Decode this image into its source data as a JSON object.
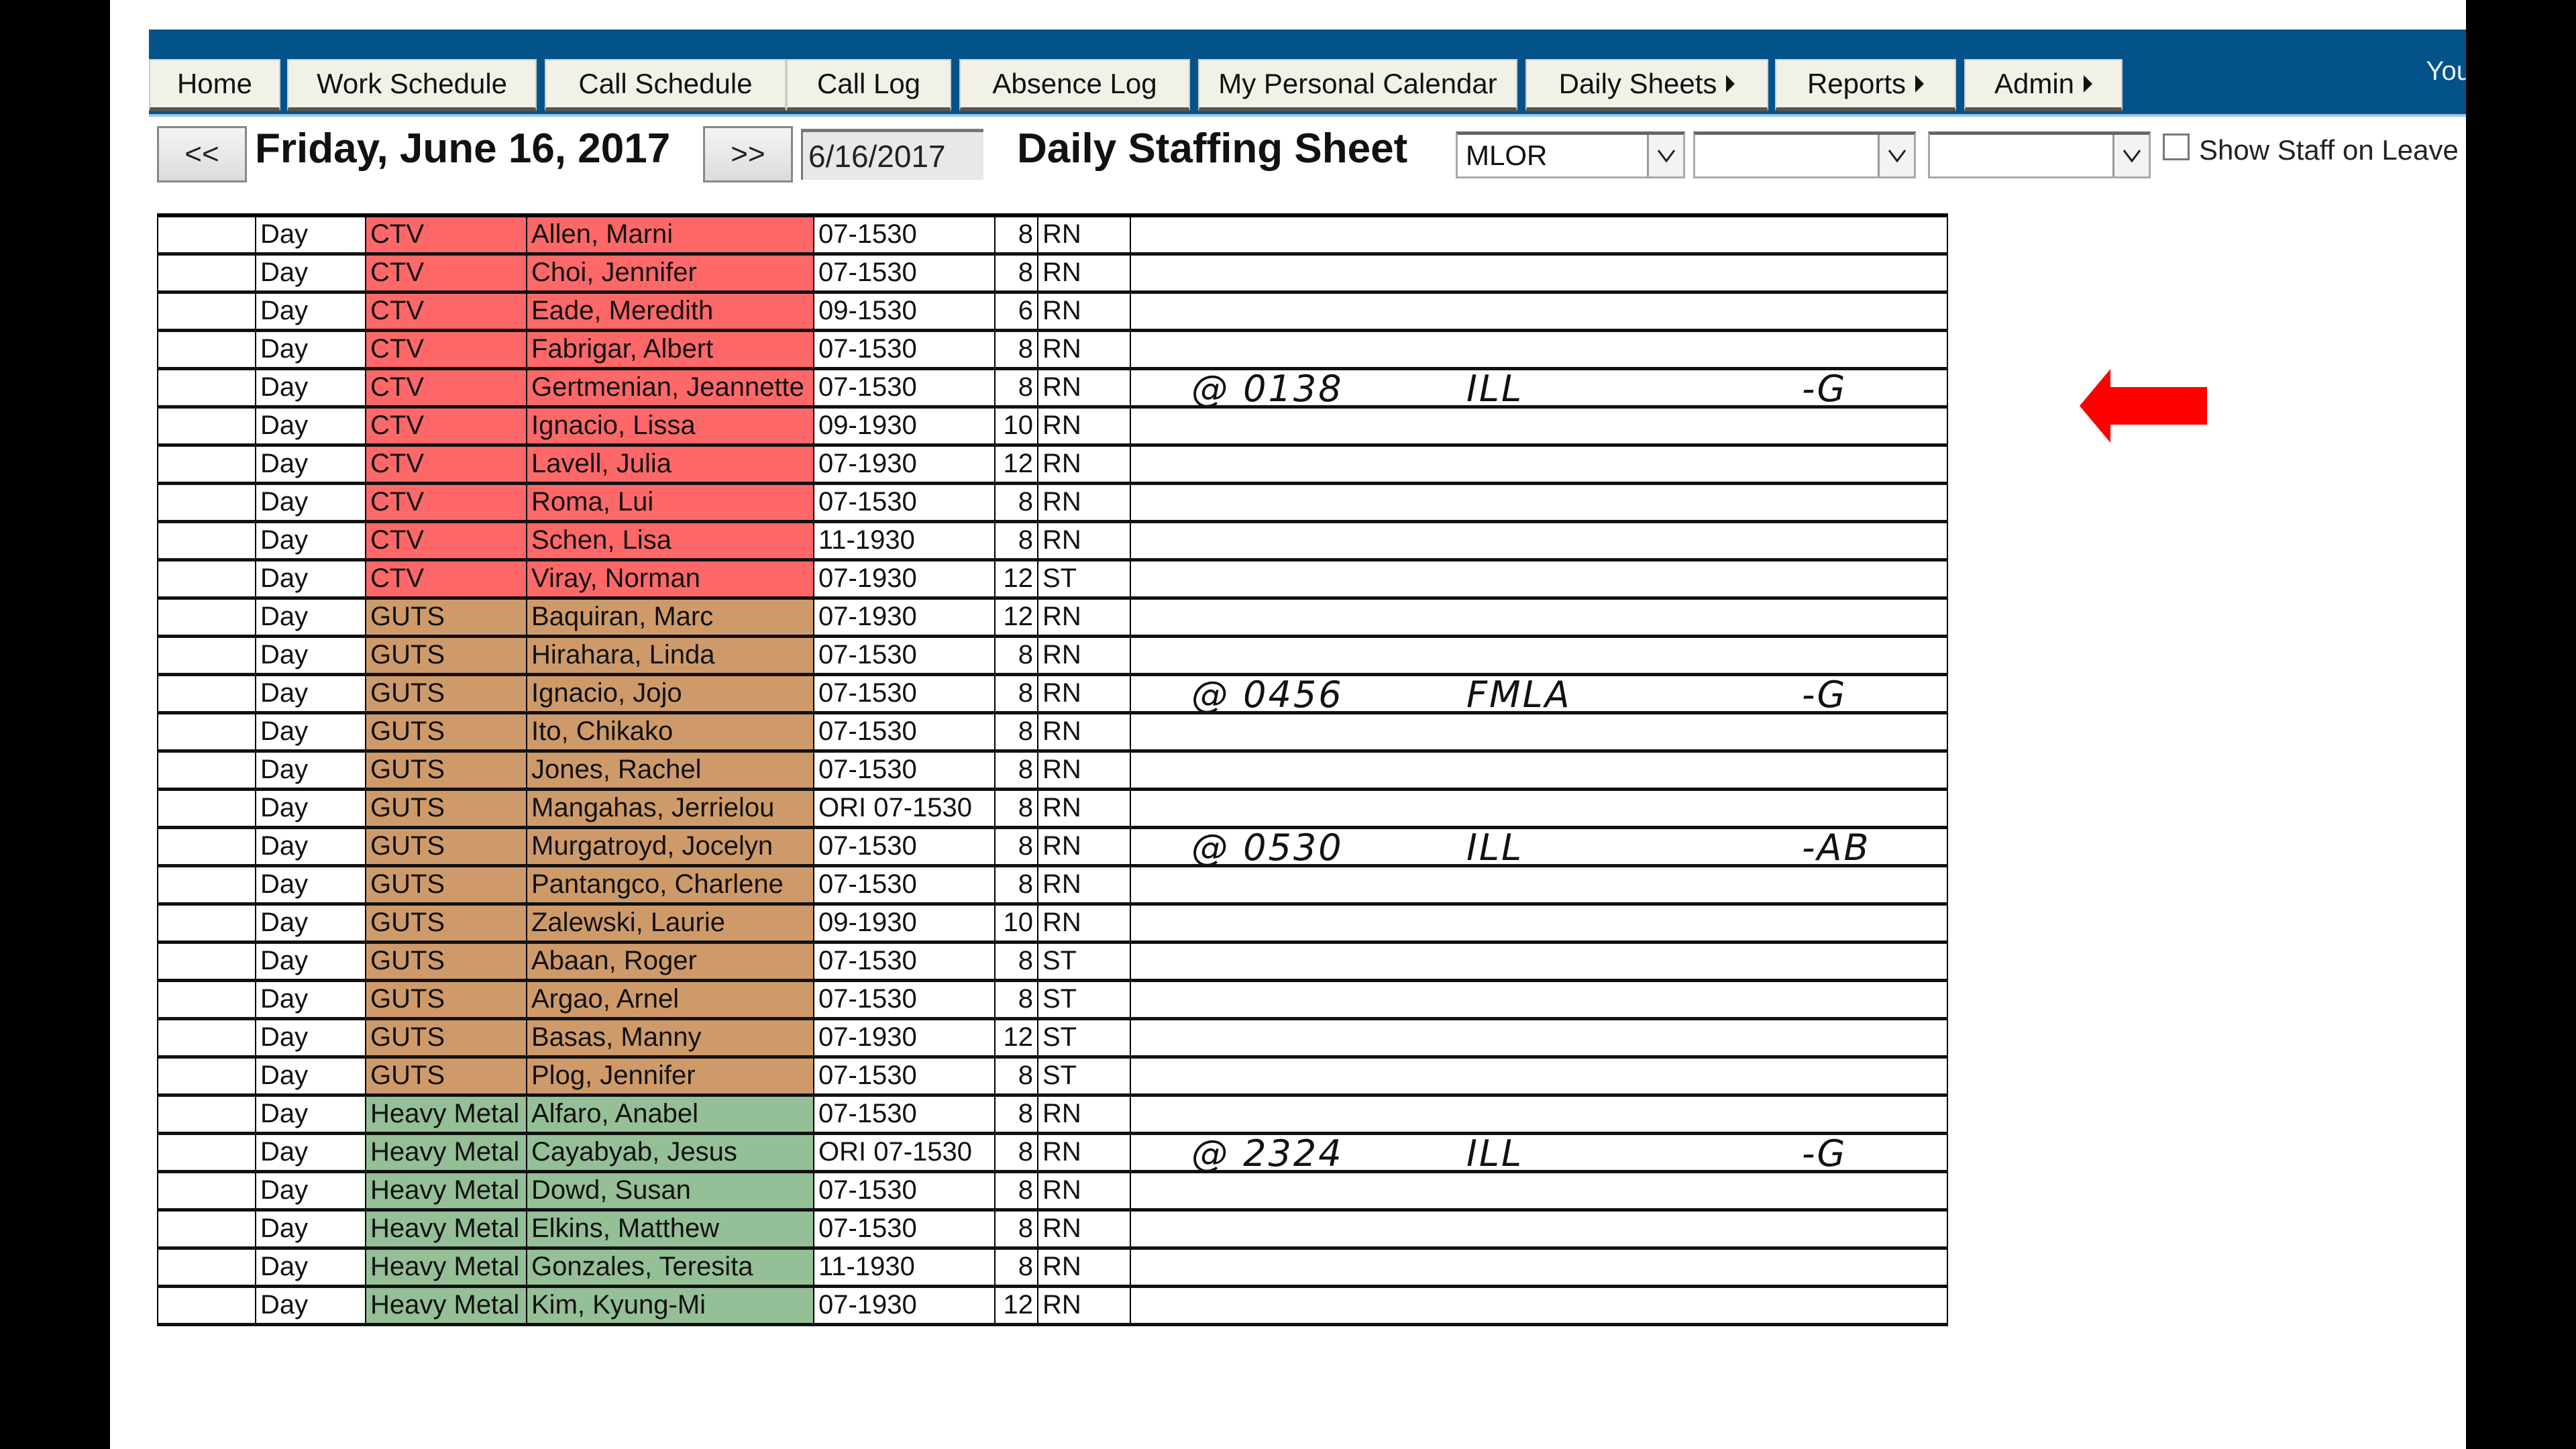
{
  "nav": {
    "items": [
      {
        "label": "Home",
        "has_submenu": false
      },
      {
        "label": "Work Schedule",
        "has_submenu": false
      },
      {
        "label": "Call Schedule",
        "has_submenu": false
      },
      {
        "label": "Call Log",
        "has_submenu": false
      },
      {
        "label": "Absence Log",
        "has_submenu": false
      },
      {
        "label": "My Personal Calendar",
        "has_submenu": false
      },
      {
        "label": "Daily Sheets",
        "has_submenu": true
      },
      {
        "label": "Reports",
        "has_submenu": true
      },
      {
        "label": "Admin",
        "has_submenu": true
      }
    ],
    "user_greeting_partial": "You",
    "bar_color": "#03538a"
  },
  "controls": {
    "prev_label": "<<",
    "next_label": ">>",
    "date_title": "Friday, June 16, 2017",
    "date_input_value": "6/16/2017",
    "sheet_title": "Daily Staffing Sheet",
    "selects": [
      {
        "value": "MLOR",
        "icon": "chevron-down-icon"
      },
      {
        "value": "",
        "icon": "chevron-down-icon"
      },
      {
        "value": "",
        "icon": "chevron-down-icon"
      }
    ],
    "show_staff_on_leave": {
      "label": "Show Staff on Leave",
      "checked": false
    }
  },
  "team_colors": {
    "CTV": "#fe6868",
    "GUTS": "#cf9a6a",
    "Heavy Metal": "#95bf96",
    "ori_text": "#2020e0"
  },
  "rows": [
    {
      "shift": "Day",
      "team": "CTV",
      "name": "Allen, Marni",
      "time": "07-1530",
      "hours": "8",
      "role": "RN",
      "note": null
    },
    {
      "shift": "Day",
      "team": "CTV",
      "name": "Choi, Jennifer",
      "time": "07-1530",
      "hours": "8",
      "role": "RN",
      "note": null
    },
    {
      "shift": "Day",
      "team": "CTV",
      "name": "Eade, Meredith",
      "time": "09-1530",
      "hours": "6",
      "role": "RN",
      "note": null
    },
    {
      "shift": "Day",
      "team": "CTV",
      "name": "Fabrigar, Albert",
      "time": "07-1530",
      "hours": "8",
      "role": "RN",
      "note": null
    },
    {
      "shift": "Day",
      "team": "CTV",
      "name": "Gertmenian, Jeannette",
      "time": "07-1530",
      "hours": "8",
      "role": "RN",
      "note": {
        "time": "@ 0138",
        "reason": "ILL",
        "initials": "-G"
      }
    },
    {
      "shift": "Day",
      "team": "CTV",
      "name": "Ignacio, Lissa",
      "time": "09-1930",
      "hours": "10",
      "role": "RN",
      "note": null
    },
    {
      "shift": "Day",
      "team": "CTV",
      "name": "Lavell, Julia",
      "time": "07-1930",
      "hours": "12",
      "role": "RN",
      "note": null
    },
    {
      "shift": "Day",
      "team": "CTV",
      "name": "Roma, Lui",
      "time": "07-1530",
      "hours": "8",
      "role": "RN",
      "note": null
    },
    {
      "shift": "Day",
      "team": "CTV",
      "name": "Schen, Lisa",
      "time": "11-1930",
      "hours": "8",
      "role": "RN",
      "note": null
    },
    {
      "shift": "Day",
      "team": "CTV",
      "name": "Viray, Norman",
      "time": "07-1930",
      "hours": "12",
      "role": "ST",
      "note": null
    },
    {
      "shift": "Day",
      "team": "GUTS",
      "name": "Baquiran, Marc",
      "time": "07-1930",
      "hours": "12",
      "role": "RN",
      "note": null
    },
    {
      "shift": "Day",
      "team": "GUTS",
      "name": "Hirahara, Linda",
      "time": "07-1530",
      "hours": "8",
      "role": "RN",
      "note": null
    },
    {
      "shift": "Day",
      "team": "GUTS",
      "name": "Ignacio, Jojo",
      "time": "07-1530",
      "hours": "8",
      "role": "RN",
      "note": {
        "time": "@ 0456",
        "reason": "FMLA",
        "initials": "-G"
      }
    },
    {
      "shift": "Day",
      "team": "GUTS",
      "name": "Ito, Chikako",
      "time": "07-1530",
      "hours": "8",
      "role": "RN",
      "note": null
    },
    {
      "shift": "Day",
      "team": "GUTS",
      "name": "Jones, Rachel",
      "time": "07-1530",
      "hours": "8",
      "role": "RN",
      "note": null
    },
    {
      "shift": "Day",
      "team": "GUTS",
      "name": "Mangahas, Jerrielou",
      "time": "ORI 07-1530",
      "hours": "8",
      "role": "RN",
      "note": null
    },
    {
      "shift": "Day",
      "team": "GUTS",
      "name": "Murgatroyd, Jocelyn",
      "time": "07-1530",
      "hours": "8",
      "role": "RN",
      "note": {
        "time": "@ 0530",
        "reason": "ILL",
        "initials": "-AB"
      }
    },
    {
      "shift": "Day",
      "team": "GUTS",
      "name": "Pantangco, Charlene",
      "time": "07-1530",
      "hours": "8",
      "role": "RN",
      "note": null
    },
    {
      "shift": "Day",
      "team": "GUTS",
      "name": "Zalewski, Laurie",
      "time": "09-1930",
      "hours": "10",
      "role": "RN",
      "note": null
    },
    {
      "shift": "Day",
      "team": "GUTS",
      "name": "Abaan, Roger",
      "time": "07-1530",
      "hours": "8",
      "role": "ST",
      "note": null
    },
    {
      "shift": "Day",
      "team": "GUTS",
      "name": "Argao, Arnel",
      "time": "07-1530",
      "hours": "8",
      "role": "ST",
      "note": null
    },
    {
      "shift": "Day",
      "team": "GUTS",
      "name": "Basas, Manny",
      "time": "07-1930",
      "hours": "12",
      "role": "ST",
      "note": null
    },
    {
      "shift": "Day",
      "team": "GUTS",
      "name": "Plog, Jennifer",
      "time": "07-1530",
      "hours": "8",
      "role": "ST",
      "note": null
    },
    {
      "shift": "Day",
      "team": "Heavy Metal",
      "name": "Alfaro, Anabel",
      "time": "07-1530",
      "hours": "8",
      "role": "RN",
      "note": null
    },
    {
      "shift": "Day",
      "team": "Heavy Metal",
      "name": "Cayabyab, Jesus",
      "time": "ORI 07-1530",
      "hours": "8",
      "role": "RN",
      "note": {
        "time": "@ 2324",
        "reason": "ILL",
        "initials": "-G"
      }
    },
    {
      "shift": "Day",
      "team": "Heavy Metal",
      "name": "Dowd, Susan",
      "time": "07-1530",
      "hours": "8",
      "role": "RN",
      "note": null
    },
    {
      "shift": "Day",
      "team": "Heavy Metal",
      "name": "Elkins, Matthew",
      "time": "07-1530",
      "hours": "8",
      "role": "RN",
      "note": null
    },
    {
      "shift": "Day",
      "team": "Heavy Metal",
      "name": "Gonzales, Teresita",
      "time": "11-1930",
      "hours": "8",
      "role": "RN",
      "note": null
    },
    {
      "shift": "Day",
      "team": "Heavy Metal",
      "name": "Kim, Kyung-Mi",
      "time": "07-1930",
      "hours": "12",
      "role": "RN",
      "note": null
    }
  ],
  "annotation": {
    "icon": "red-arrow-left-icon",
    "points_to_row": "Gertmenian, Jeannette",
    "color": "#ff0000"
  }
}
